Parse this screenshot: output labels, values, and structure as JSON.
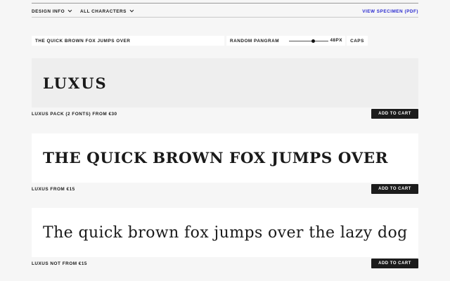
{
  "nav": {
    "design_info": "DESIGN INFO",
    "all_characters": "ALL CHARACTERS",
    "view_specimen": "VIEW SPECIMEN (PDF)"
  },
  "controls": {
    "sample_text": "THE QUICK BROWN FOX JUMPS OVER",
    "random_pangram": "RANDOM PANGRAM",
    "size_value": "48PX",
    "size_fraction": 0.62,
    "caps": "CAPS"
  },
  "fonts": [
    {
      "specimen": "LUXUS",
      "product": "LUXUS PACK (2 FONTS) FROM €30",
      "cart": "ADD TO CART"
    },
    {
      "specimen": "THE QUICK BROWN FOX JUMPS OVER",
      "product": "LUXUS FROM €15",
      "cart": "ADD TO CART"
    },
    {
      "specimen": "The quick brown fox jumps over the lazy dog",
      "product": "LUXUS NOT FROM €15",
      "cart": "ADD TO CART"
    }
  ],
  "colors": {
    "background": "#f6f6f6",
    "link": "#2b2bd0",
    "button": "#1c1c1c"
  }
}
